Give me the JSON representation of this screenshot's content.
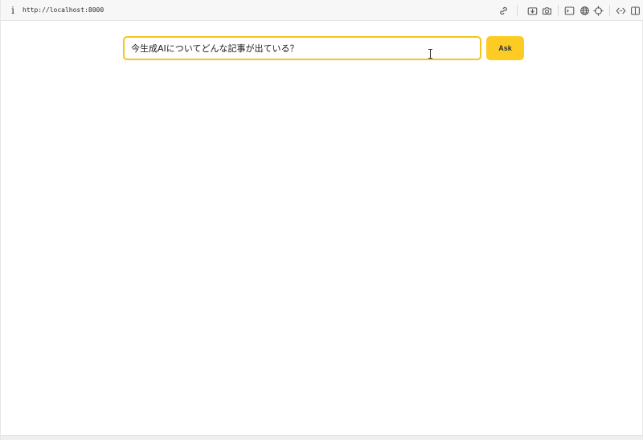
{
  "browser": {
    "url": "http://localhost:8000",
    "info_icon": "i",
    "toolbar_icons": [
      "link-icon",
      "download-icon",
      "camera-icon",
      "terminal-icon",
      "globe-icon",
      "crosshair-icon",
      "code-icon",
      "split-panel-icon"
    ]
  },
  "query": {
    "value": "今生成AIについてどんな記事が出ている？",
    "placeholder": ""
  },
  "ask_button": {
    "label": "Ask"
  },
  "colors": {
    "accent": "#fccc25",
    "input_border": "#f5c518",
    "button_text": "#1f2a44"
  }
}
